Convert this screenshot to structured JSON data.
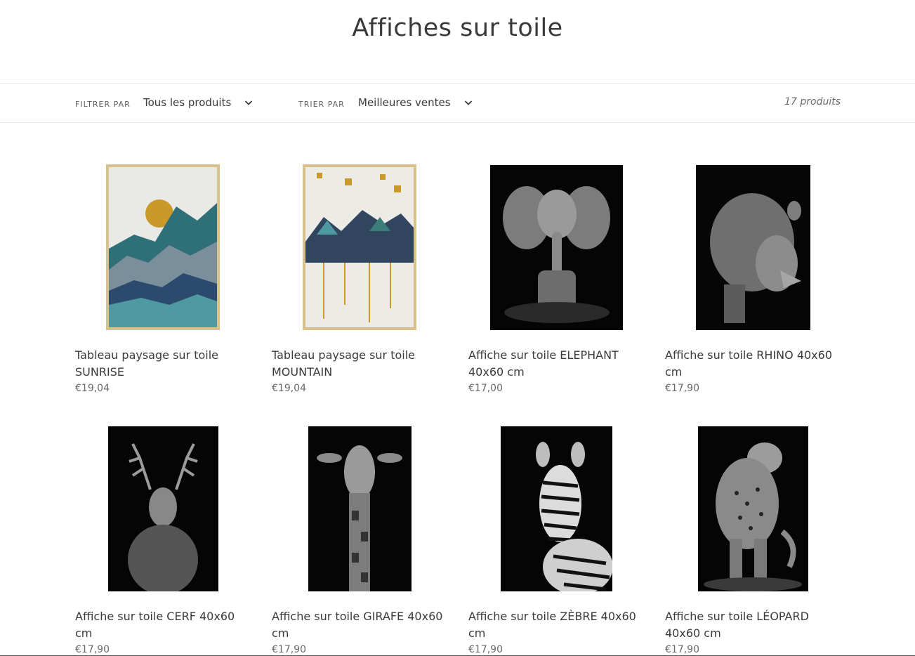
{
  "page": {
    "title": "Affiches sur toile"
  },
  "toolbar": {
    "filter_label": "FILTRER PAR",
    "filter_value": "Tous les produits",
    "sort_label": "TRIER PAR",
    "sort_value": "Meilleures ventes",
    "product_count": "17 produits"
  },
  "products": [
    {
      "title": "Tableau paysage sur toile SUNRISE",
      "price": "€19,04",
      "image": "abstract-sunrise-mountains"
    },
    {
      "title": "Tableau paysage sur toile MOUNTAIN",
      "price": "€19,04",
      "image": "abstract-gold-mountains"
    },
    {
      "title": "Affiche sur toile ELEPHANT 40x60 cm",
      "price": "€17,00",
      "image": "elephant-bw"
    },
    {
      "title": "Affiche sur toile RHINO 40x60 cm",
      "price": "€17,90",
      "image": "rhino-bw"
    },
    {
      "title": "Affiche sur toile CERF 40x60 cm",
      "price": "€17,90",
      "image": "deer-bw"
    },
    {
      "title": "Affiche sur toile GIRAFE 40x60 cm",
      "price": "€17,90",
      "image": "giraffe-bw"
    },
    {
      "title": "Affiche sur toile ZÈBRE 40x60 cm",
      "price": "€17,90",
      "image": "zebra-bw"
    },
    {
      "title": "Affiche sur toile LÉOPARD 40x60 cm",
      "price": "€17,90",
      "image": "leopard-bw"
    }
  ]
}
